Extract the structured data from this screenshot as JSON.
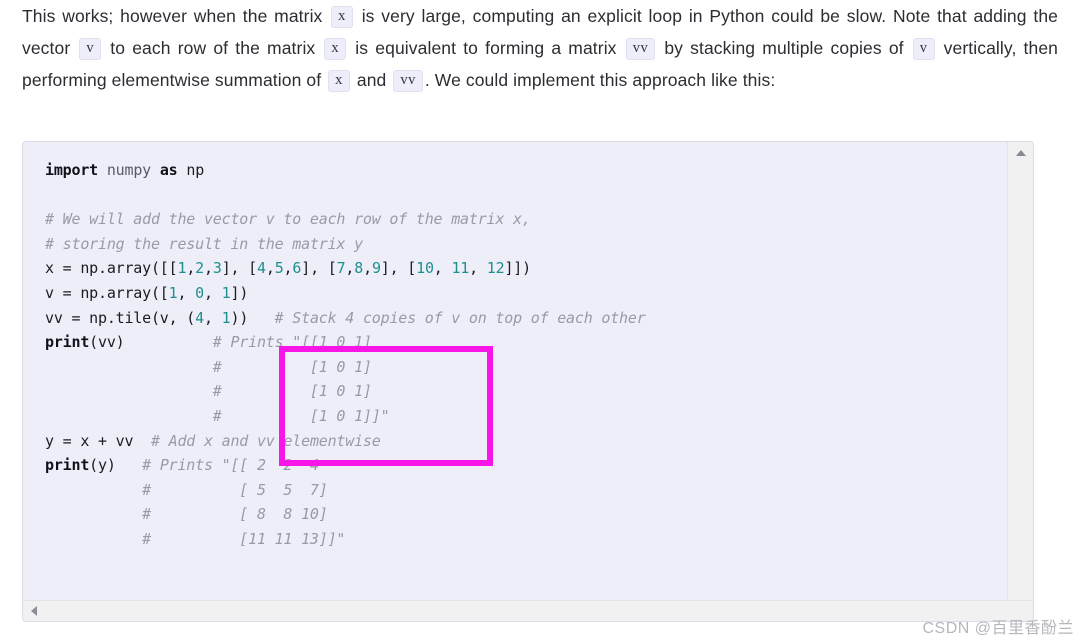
{
  "article": {
    "paragraph_segments": [
      {
        "type": "text",
        "value": "This works; however when the matrix "
      },
      {
        "type": "code",
        "value": "x"
      },
      {
        "type": "text",
        "value": " is very large, computing an explicit loop in Python could be slow. Note that adding the vector "
      },
      {
        "type": "code",
        "value": "v"
      },
      {
        "type": "text",
        "value": " to each row of the matrix "
      },
      {
        "type": "code",
        "value": "x"
      },
      {
        "type": "text",
        "value": " is equivalent to forming a matrix "
      },
      {
        "type": "code",
        "value": "vv"
      },
      {
        "type": "text",
        "value": " by stacking multiple copies of "
      },
      {
        "type": "code",
        "value": "v"
      },
      {
        "type": "text",
        "value": " vertically, then performing elementwise summation of "
      },
      {
        "type": "code",
        "value": "x"
      },
      {
        "type": "text",
        "value": " and "
      },
      {
        "type": "code",
        "value": "vv"
      },
      {
        "type": "text",
        "value": ". We could implement this approach like this:"
      }
    ],
    "paragraph_plain": "This works; however when the matrix x is very large, computing an explicit loop in Python could be slow. Note that adding the vector v to each row of the matrix x is equivalent to forming a matrix vv by stacking multiple copies of v vertically, then performing elementwise summation of x and vv. We could implement this approach like this:"
  },
  "code_block": {
    "language": "python",
    "lines": [
      "import numpy as np",
      "",
      "# We will add the vector v to each row of the matrix x,",
      "# storing the result in the matrix y",
      "x = np.array([[1,2,3], [4,5,6], [7,8,9], [10, 11, 12]])",
      "v = np.array([1, 0, 1])",
      "vv = np.tile(v, (4, 1))   # Stack 4 copies of v on top of each other",
      "print(vv)          # Prints \"[[1 0 1]",
      "                   #          [1 0 1]",
      "                   #          [1 0 1]",
      "                   #          [1 0 1]]\"",
      "y = x + vv  # Add x and vv elementwise",
      "print(y)   # Prints \"[[ 2  2  4",
      "           #          [ 5  5  7]",
      "           #          [ 8  8 10]",
      "           #          [11 11 13]]\""
    ],
    "tokens": {
      "keyword_import": "import",
      "keyword_as": "as",
      "module_numpy": "numpy",
      "alias_np": "np",
      "builtin_print": "print",
      "comment_1": "# We will add the vector v to each row of the matrix x,",
      "comment_2": "# storing the result in the matrix y",
      "comment_stack": "# Stack 4 copies of v on top of each other",
      "comment_prints_vv_1": "# Prints \"[[1 0 1]",
      "comment_prints_vv_2": "#          [1 0 1]",
      "comment_prints_vv_3": "#          [1 0 1]",
      "comment_prints_vv_4": "#          [1 0 1]]\"",
      "comment_add": "# Add x and vv elementwise",
      "comment_prints_y_1": "# Prints \"[[ 2  2  4",
      "comment_prints_y_2": "#          [ 5  5  7]",
      "comment_prints_y_3": "#          [ 8  8 10]",
      "comment_prints_y_4": "#          [11 11 13]]\""
    },
    "data": {
      "matrix_x": [
        [
          1,
          2,
          3
        ],
        [
          4,
          5,
          6
        ],
        [
          7,
          8,
          9
        ],
        [
          10,
          11,
          12
        ]
      ],
      "vector_v": [
        1,
        0,
        1
      ],
      "tile_reps": [
        4,
        1
      ],
      "matrix_vv": [
        [
          1,
          0,
          1
        ],
        [
          1,
          0,
          1
        ],
        [
          1,
          0,
          1
        ],
        [
          1,
          0,
          1
        ]
      ],
      "matrix_y": [
        [
          2,
          2,
          4
        ],
        [
          5,
          5,
          7
        ],
        [
          8,
          8,
          10
        ],
        [
          11,
          11,
          13
        ]
      ]
    },
    "colors": {
      "background": "#eeeef9",
      "border": "#dcdce8",
      "text": "#1b1b20",
      "number": "#1d8f8f",
      "comment": "#9a9aa6",
      "module": "#5a5a66"
    }
  },
  "annotation": {
    "type": "rectangle-highlight",
    "color": "#f715e8",
    "border_width_px": 6,
    "region_label": "vv print output block"
  },
  "scrollbars": {
    "vertical": {
      "arrow_up_icon": "triangle-up-icon",
      "position": "right"
    },
    "horizontal": {
      "arrow_left_icon": "triangle-left-icon",
      "position": "bottom"
    }
  },
  "watermark": {
    "text": "CSDN @百里香酚兰",
    "color": "#b6b6bd"
  }
}
